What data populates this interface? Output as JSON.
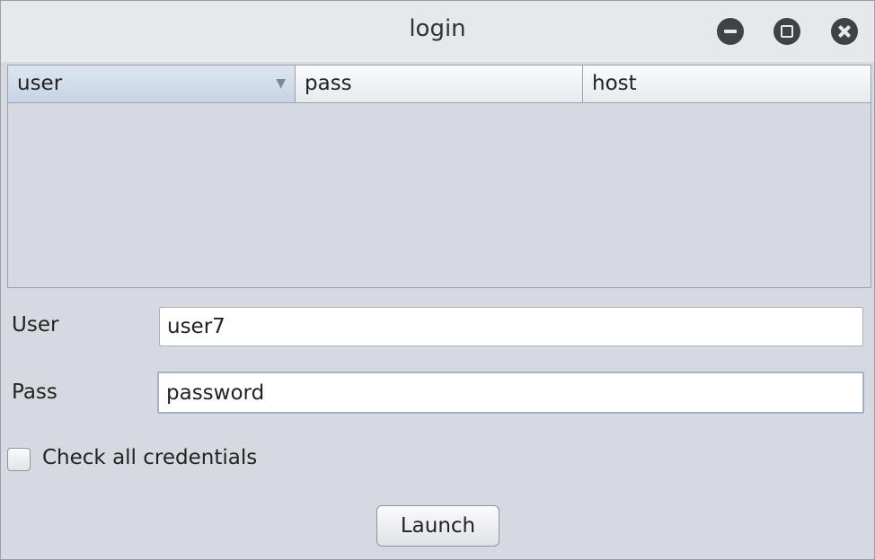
{
  "window": {
    "title": "login",
    "controls": {
      "minimize_icon": "minimize-icon",
      "maximize_icon": "maximize-icon",
      "close_icon": "close-icon"
    }
  },
  "table": {
    "columns": [
      {
        "label": "user",
        "sorted": true,
        "sort_icon": "sort-descending-icon"
      },
      {
        "label": "pass"
      },
      {
        "label": "host"
      }
    ],
    "rows": []
  },
  "form": {
    "user_label": "User",
    "user_value": "user7",
    "pass_label": "Pass",
    "pass_value": "password",
    "check_all_label": "Check all credentials",
    "check_all_checked": false,
    "launch_label": "Launch"
  },
  "colors": {
    "background": "#d6d9df",
    "titlebar": "#e7e8eb",
    "sorted_header": "#c8d4e4",
    "focus_border": "#9fb3cc"
  }
}
